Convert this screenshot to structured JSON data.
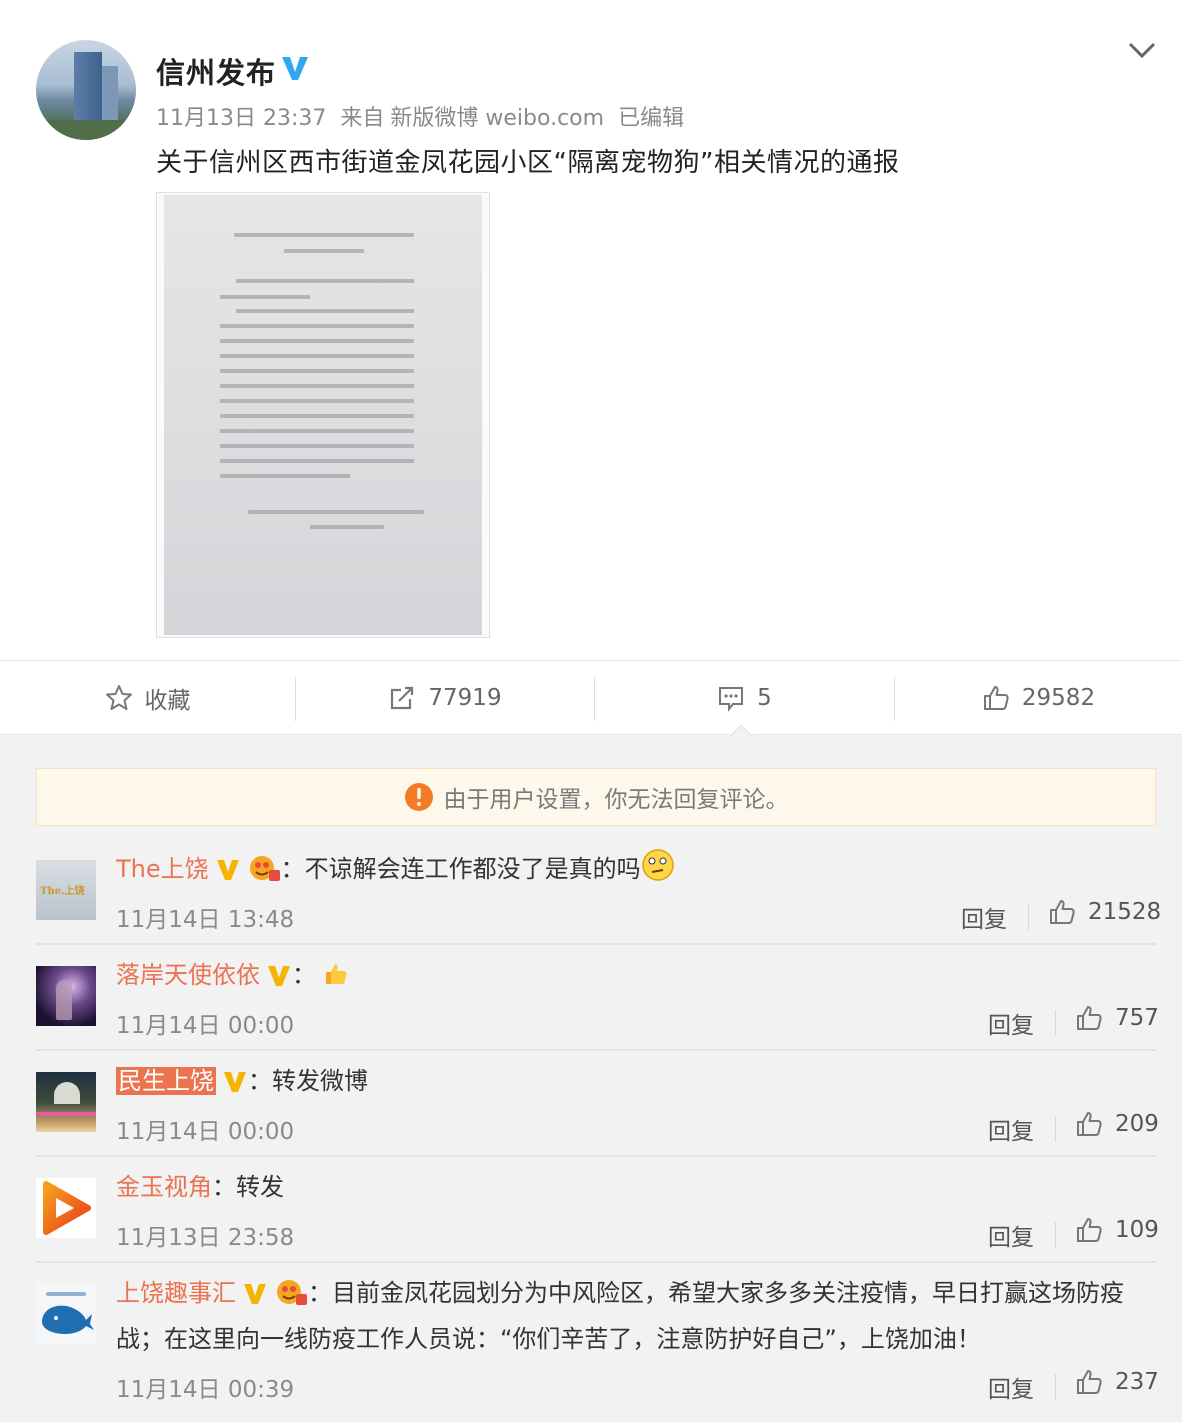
{
  "post": {
    "author": "信州发布",
    "time": "11月13日 23:37",
    "source_prefix": "来自",
    "source": "新版微博 weibo.com",
    "edited": "已编辑",
    "text": "关于信州区西市街道金凤花园小区“隔离宠物狗”相关情况的通报"
  },
  "actions": {
    "favorite": "收藏",
    "repost_count": "77919",
    "comment_count": "5",
    "like_count": "29582"
  },
  "notice": "由于用户设置，你无法回复评论。",
  "comments": [
    {
      "user": "The上饶",
      "text": "：不谅解会连工作都没了是真的吗",
      "time": "11月14日 13:48",
      "reply": "回复",
      "likes": "21528"
    },
    {
      "user": "落岸天使依依",
      "text": "：",
      "time": "11月14日 00:00",
      "reply": "回复",
      "likes": "757"
    },
    {
      "user": "民生上饶",
      "text": "：转发微博",
      "time": "11月14日 00:00",
      "reply": "回复",
      "likes": "209"
    },
    {
      "user": "金玉视角",
      "text": "：转发",
      "time": "11月13日 23:58",
      "reply": "回复",
      "likes": "109"
    },
    {
      "user": "上饶趣事汇",
      "text": "：目前金凤花园划分为中风险区，希望大家多多关注疫情，早日打赢这场防疫战；在这里向一线防疫工作人员说：“你们辛苦了，注意防护好自己”，上饶加油！",
      "time": "11月14日 00:39",
      "reply": "回复",
      "likes": "237"
    }
  ],
  "colors": {
    "username": "#eb7350",
    "verified_gold": "#f5b400",
    "verified_blue": "#2ea9ef"
  },
  "icons": [
    "star-icon",
    "repost-icon",
    "comment-icon",
    "thumbs-up-icon",
    "warning-icon",
    "chevron-down-icon",
    "verified-badge-icon"
  ]
}
